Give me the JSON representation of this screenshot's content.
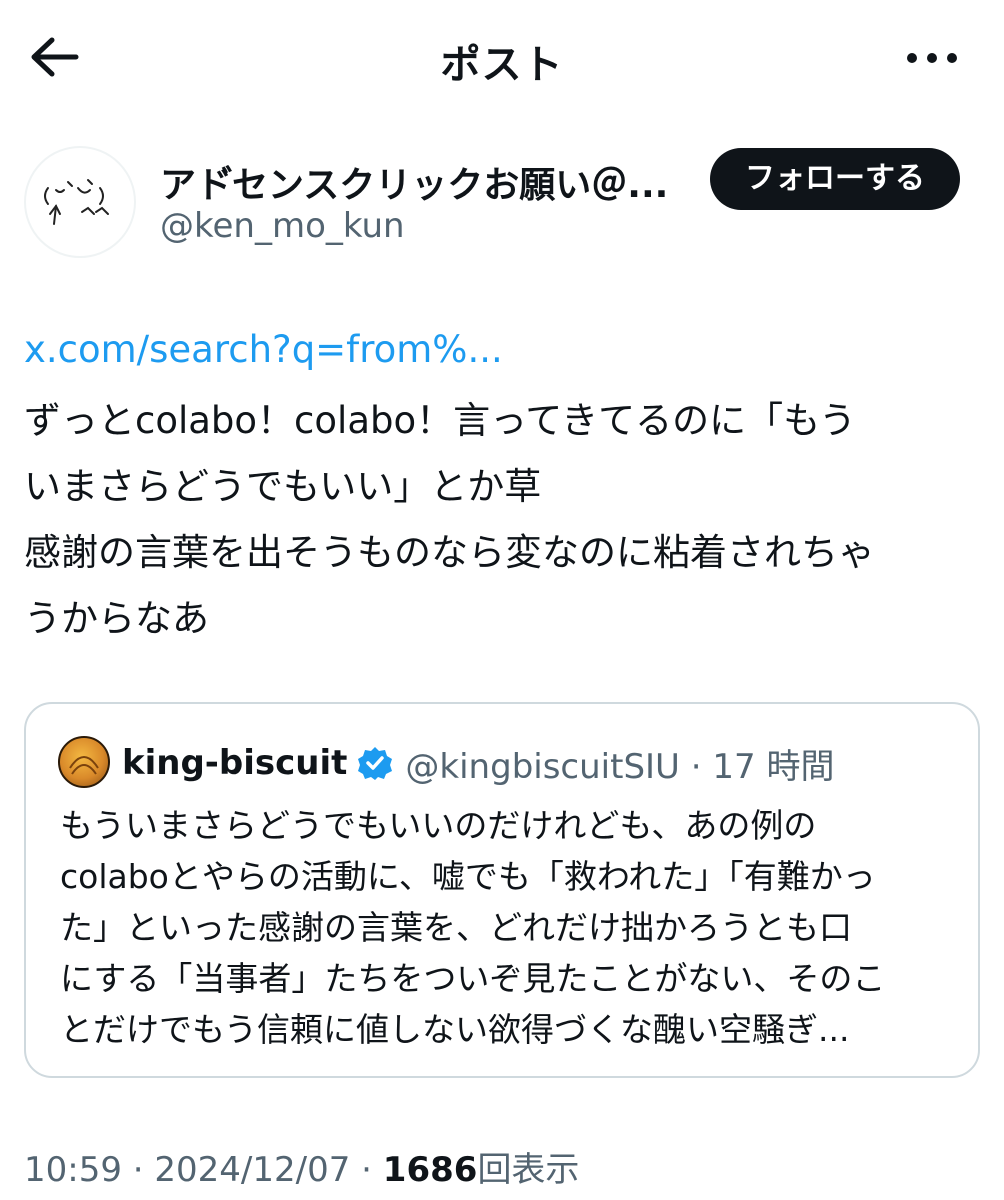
{
  "header": {
    "title": "ポスト",
    "back_icon": "arrow-left-icon",
    "more_icon": "more-dots-icon"
  },
  "author": {
    "name": "アド゙センスクリックお願い＠...",
    "handle": "@ken_mo_kun",
    "follow_label": "フォローする"
  },
  "post": {
    "link": "x.com/search?q=from%...",
    "lines": [
      "ずっとcolabo！colabo！言ってきてるのに「もう",
      "いまさらどうでもいい」とか草",
      "感謝の言葉を出そうものなら変なのに粘着されちゃ",
      "うからなあ"
    ]
  },
  "quote": {
    "name": "king-biscuit",
    "verified_icon": "verified-badge-icon",
    "handle_time": "@kingbiscuitSIU · 17 時間",
    "lines": [
      "もういまさらどうでもいいのだけれども、あの例の",
      "colaboとやらの活動に、嘘でも「救われた」「有難かっ",
      "た」といった感謝の言葉を、どれだけ拙かろうとも口",
      "にする「当事者」たちをついぞ見たことがない、そのこ",
      "とだけでもう信頼に値しない欲得づくな醜い空騒ぎ..."
    ]
  },
  "meta": {
    "time_date": "10:59 · 2024/12/07 · ",
    "views_count": "1686",
    "views_label": "回表示"
  },
  "colors": {
    "link": "#1d9bf0",
    "text": "#0f1419",
    "muted": "#536471",
    "verified": "#1d9bf0",
    "follow_bg": "#0f1419"
  }
}
